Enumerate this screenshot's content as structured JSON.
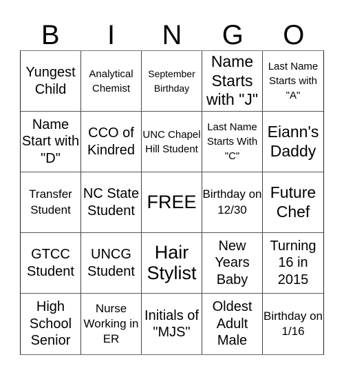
{
  "header": {
    "letters": [
      "B",
      "I",
      "N",
      "G",
      "O"
    ]
  },
  "card": {
    "rows": [
      [
        {
          "text": "Yungest Child"
        },
        {
          "text": "Analytical Chemist"
        },
        {
          "text": "September Birthday"
        },
        {
          "text": "Name Starts with \"J\""
        },
        {
          "text": "Last Name Starts with \"A\""
        }
      ],
      [
        {
          "text": "Name Start with \"D\""
        },
        {
          "text": "CCO of Kindred"
        },
        {
          "text": "UNC Chapel Hill Student"
        },
        {
          "text": "Last Name Starts With \"C\""
        },
        {
          "text": "Eiann's Daddy"
        }
      ],
      [
        {
          "text": "Transfer Student"
        },
        {
          "text": "NC State Student"
        },
        {
          "text": "FREE"
        },
        {
          "text": "Birthday on 12/30"
        },
        {
          "text": "Future Chef"
        }
      ],
      [
        {
          "text": "GTCC Student"
        },
        {
          "text": "UNCG Student"
        },
        {
          "text": "Hair Stylist"
        },
        {
          "text": "New Years Baby"
        },
        {
          "text": "Turning 16 in 2015"
        }
      ],
      [
        {
          "text": "High School Senior"
        },
        {
          "text": "Nurse Working in ER"
        },
        {
          "text": "Initials of \"MJS\""
        },
        {
          "text": "Oldest Adult Male"
        },
        {
          "text": "Birthday on 1/16"
        }
      ]
    ]
  }
}
